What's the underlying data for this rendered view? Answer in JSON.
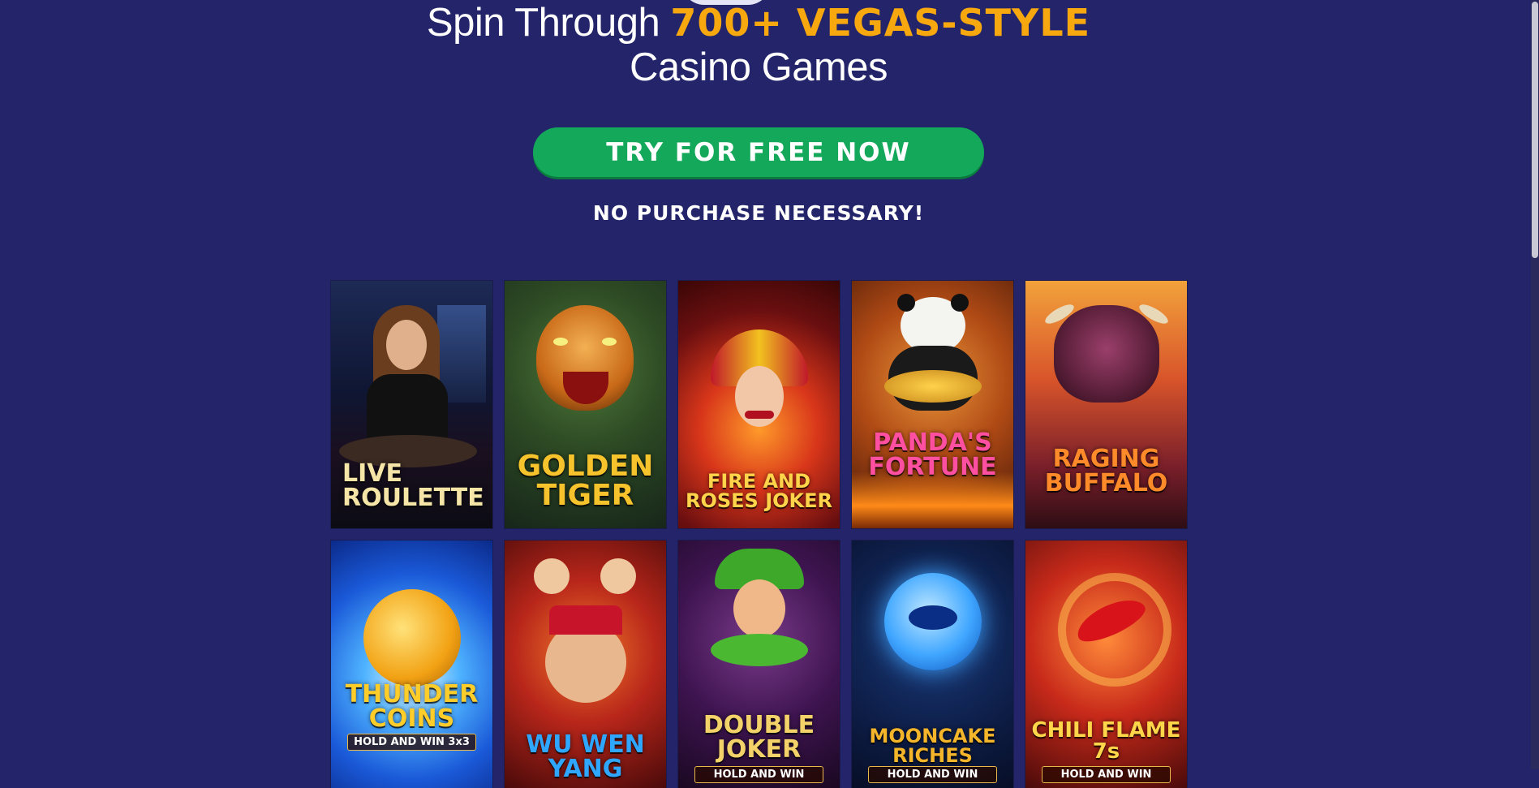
{
  "hero": {
    "line1_prefix": "Spin Through ",
    "line1_accent": "700+ VEGAS-STYLE",
    "line2": "Casino Games"
  },
  "cta": {
    "label": "TRY FOR FREE NOW"
  },
  "note": "NO PURCHASE NECESSARY!",
  "colors": {
    "background": "#23246a",
    "accent": "#f7a80f",
    "button": "#13a85a"
  },
  "games": [
    {
      "title": "LIVE ROULETTE",
      "subtitle": ""
    },
    {
      "title": "GOLDEN TIGER",
      "subtitle": ""
    },
    {
      "title": "FIRE AND ROSES JOKER",
      "subtitle": ""
    },
    {
      "title": "PANDA'S FORTUNE",
      "subtitle": ""
    },
    {
      "title": "RAGING BUFFALO",
      "subtitle": ""
    },
    {
      "title": "THUNDER COINS",
      "subtitle": "HOLD AND WIN 3x3"
    },
    {
      "title": "WU WEN YANG",
      "subtitle": ""
    },
    {
      "title": "DOUBLE JOKER",
      "subtitle": "HOLD AND WIN"
    },
    {
      "title": "MOONCAKE RICHES",
      "subtitle": "HOLD AND WIN"
    },
    {
      "title": "CHILI FLAME 7s",
      "subtitle": "HOLD AND WIN"
    }
  ]
}
